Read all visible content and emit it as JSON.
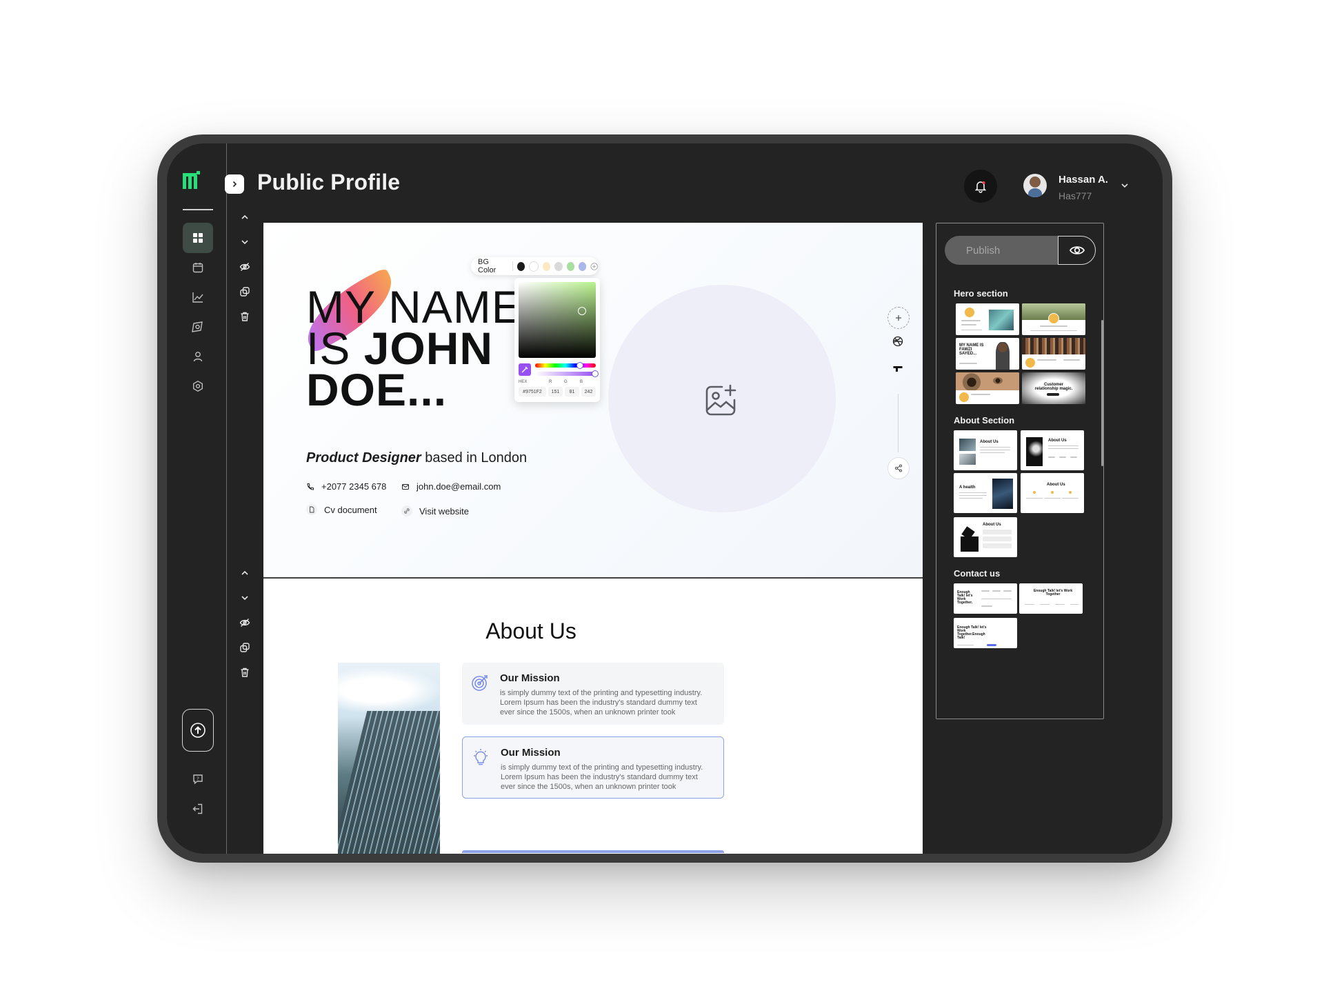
{
  "app": {
    "title": "Public Profile"
  },
  "user": {
    "name": "Hassan A.",
    "handle": "Has777"
  },
  "hero": {
    "title_line1": "MY NAME",
    "title_line2_a": "IS ",
    "title_line2_b": "JOHN",
    "title_line3": "DOE...",
    "role": "Product Designer",
    "location": " based in London",
    "phone": "+2077 2345 678",
    "email": "john.doe@email.com",
    "cv": "Cv document",
    "website": "Visit website"
  },
  "color_picker": {
    "label": "BG Color",
    "swatches": [
      "#1b1b1b",
      "#ffffff",
      "#fde8c4",
      "#dadada",
      "#a8dfa0",
      "#a9b7ea"
    ],
    "hex_label": "HEX",
    "r_label": "R",
    "g_label": "G",
    "b_label": "B",
    "hex": "#9751F2",
    "r": "151",
    "g": "81",
    "b": "242"
  },
  "about": {
    "title": "About Us",
    "cards": [
      {
        "title": "Our Mission",
        "text": " is simply dummy text of the printing and typesetting industry. Lorem Ipsum has been the industry's standard dummy text ever since the 1500s, when an unknown printer took"
      },
      {
        "title": "Our Mission",
        "text": " is simply dummy text of the printing and typesetting industry. Lorem Ipsum has been the industry's standard dummy text ever since the 1500s, when an unknown printer took"
      }
    ]
  },
  "panel": {
    "publish_label": "Publish",
    "sections": {
      "hero": "Hero section",
      "about": "About Section",
      "contact": "Contact us"
    },
    "thumbs": {
      "hero_3_title": "MY NAME IS FAWZI SAYED...",
      "hero_6_title": "Customer relationship magic.",
      "about_title": "About Us",
      "about_3_title": "A health",
      "contact_1_title": "Enough Talk! let's Work Together.",
      "contact_2_title": "Enough Talk! let's Work Together",
      "contact_3_title": "Enough Talk! let's Work Together.Enough Talk!"
    }
  },
  "colors": {
    "accent_green": "#27e07a",
    "brand_purple": "#9751f2",
    "frame": "#3b3b3b",
    "screen": "#232323"
  }
}
